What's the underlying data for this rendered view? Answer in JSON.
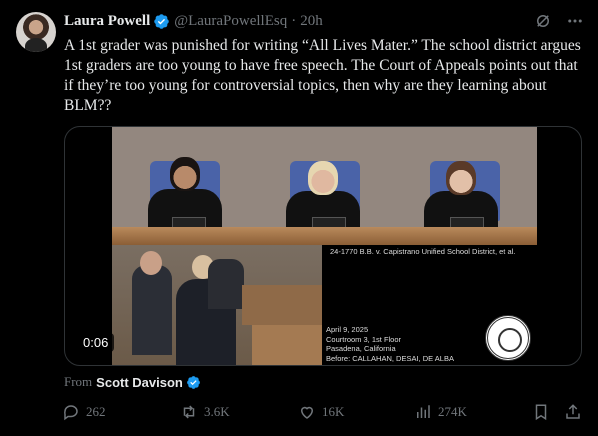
{
  "author": {
    "name": "Laura Powell",
    "handle": "@LauraPowellEsq",
    "separator": "·",
    "time": "20h"
  },
  "tweet_text": "A 1st grader was punished for writing “All Lives Mater.” The school district argues 1st graders are too young to have free speech. The Court of Appeals points out that if they’re too young for controversial topics, then why are they learning about BLM??",
  "video": {
    "caption_case": "24-1770 B.B. v. Capistrano Unified School District, et al.",
    "date": "April 9, 2025",
    "courtroom": "Courtroom 3, 1st Floor",
    "location": "Pasadena, California",
    "panel": "Before: CALLAHAN, DESAI, DE ALBA",
    "timestamp": "0:06"
  },
  "source": {
    "prefix": "From",
    "name": "Scott Davison"
  },
  "actions": {
    "replies": "262",
    "reposts": "3.6K",
    "likes": "16K",
    "views": "274K"
  },
  "colors": {
    "verified": "#1d9bf0",
    "muted": "#71767b",
    "text": "#e7e9ea",
    "background": "#000000"
  },
  "icons": [
    "grok-icon",
    "more-icon",
    "reply-icon",
    "repost-icon",
    "like-icon",
    "views-icon",
    "bookmark-icon",
    "share-icon",
    "verified-badge-icon"
  ]
}
